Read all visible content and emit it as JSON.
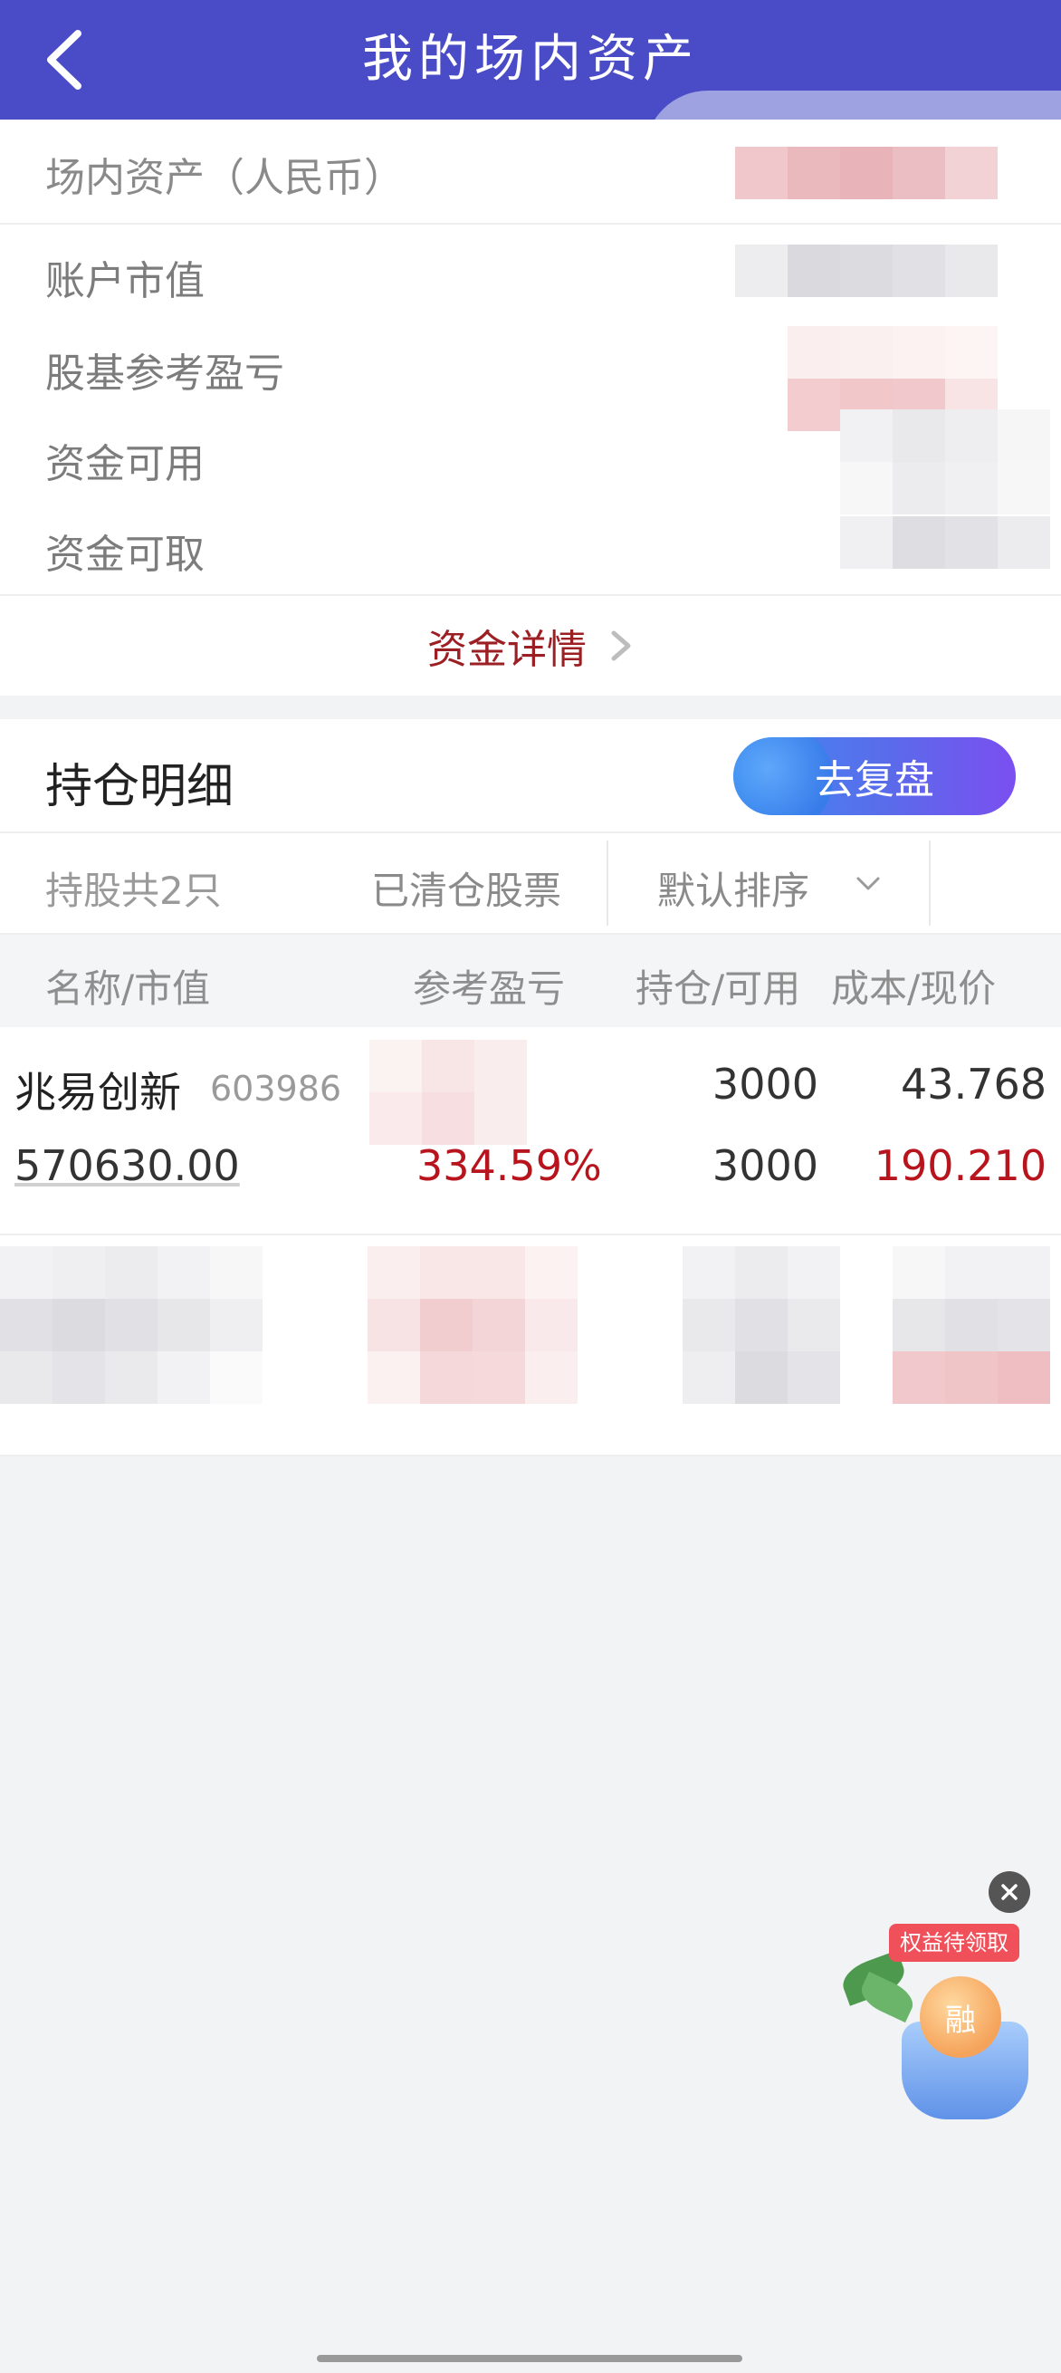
{
  "header": {
    "title": "我的场内资产",
    "back_icon": "chevron-left-icon"
  },
  "assets": {
    "main_label": "场内资产（人民币）",
    "rows": [
      {
        "label": "账户市值"
      },
      {
        "label": "股基参考盈亏"
      },
      {
        "label": "资金可用"
      },
      {
        "label": "资金可取"
      }
    ],
    "detail_link": "资金详情"
  },
  "holdings": {
    "title": "持仓明细",
    "review_button": "去复盘",
    "count": "持股共2只",
    "cleared": "已清仓股票",
    "sort": "默认排序",
    "columns": {
      "name": "名称/市值",
      "pnl": "参考盈亏",
      "position": "持仓/可用",
      "cost": "成本/现价"
    },
    "items": [
      {
        "name": "兆易创新",
        "code": "603986",
        "market_value": "570630.00",
        "pnl_pct": "334.59%",
        "position": "3000",
        "available": "3000",
        "cost": "43.768",
        "price": "190.210"
      }
    ]
  },
  "promo": {
    "tag": "权益待领取",
    "coin": "融"
  },
  "colors": {
    "header_bg": "#4a4cc7",
    "loss_gain_red": "#b8141d",
    "detail_link": "#9c1f24"
  }
}
